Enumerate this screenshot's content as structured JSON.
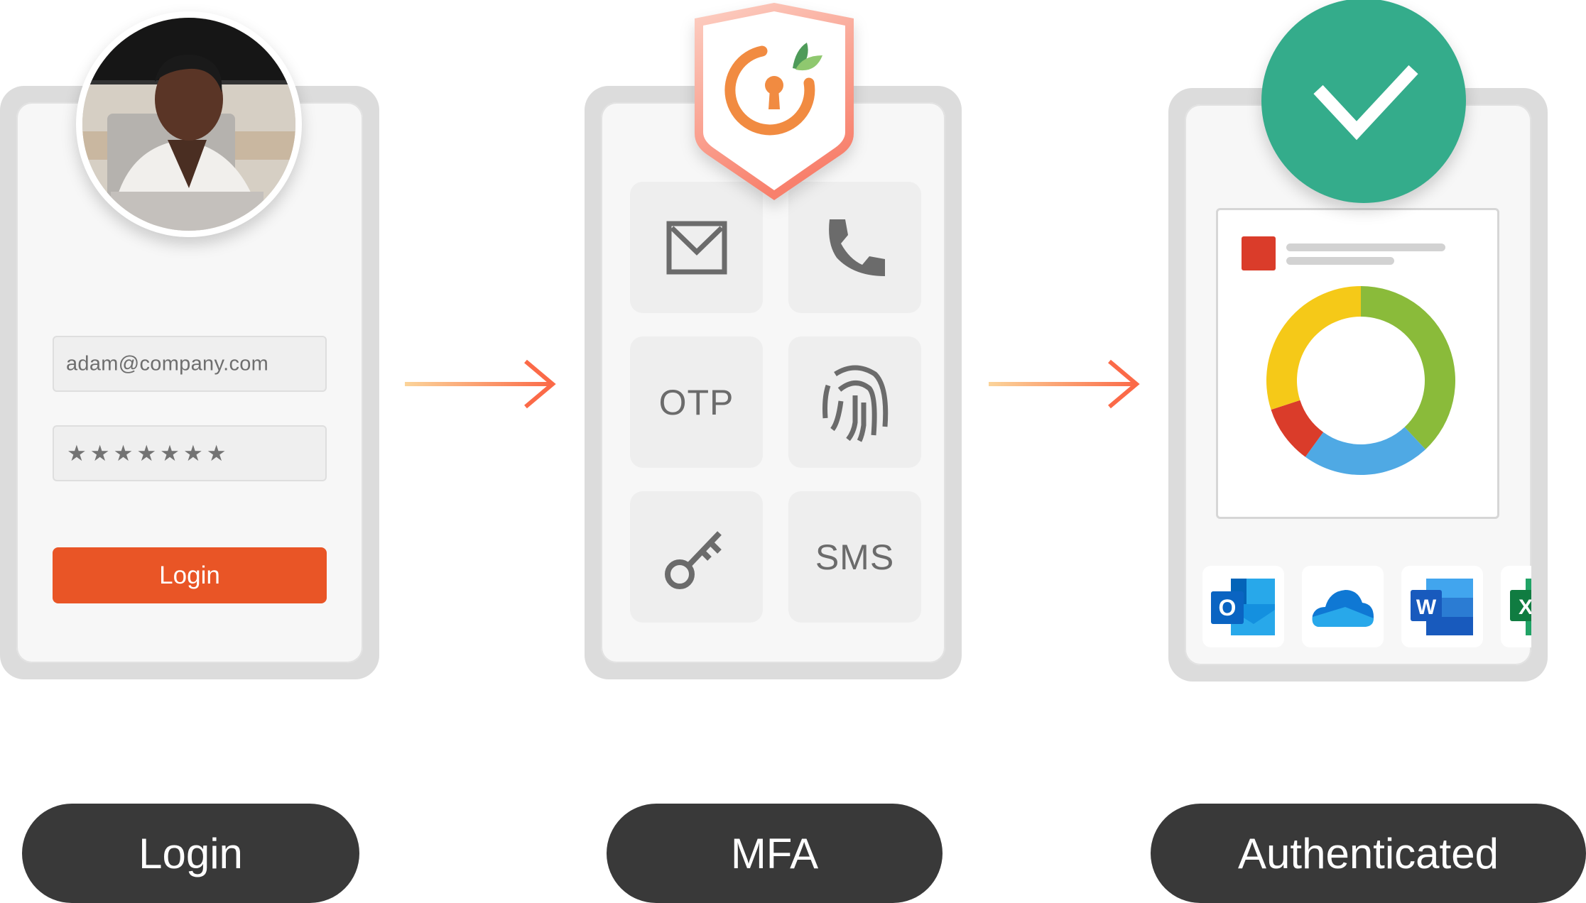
{
  "steps": [
    {
      "label": "Login"
    },
    {
      "label": "MFA"
    },
    {
      "label": "Authenticated"
    }
  ],
  "login_card": {
    "email_value": "adam@company.com",
    "password_mask": "★★★★★★★",
    "login_button": "Login"
  },
  "mfa_card": {
    "methods": [
      {
        "name": "Email",
        "icon": "envelope-icon"
      },
      {
        "name": "Phone call",
        "icon": "phone-icon"
      },
      {
        "name": "OTP",
        "text": "OTP"
      },
      {
        "name": "Biometric",
        "icon": "fingerprint-icon"
      },
      {
        "name": "Security key",
        "icon": "key-icon"
      },
      {
        "name": "SMS",
        "text": "SMS"
      }
    ]
  },
  "authenticated_card": {
    "apps": [
      "Outlook",
      "OneDrive",
      "Word",
      "Excel"
    ]
  },
  "colors": {
    "accent_orange": "#e95526",
    "shield_border": "#f8917a",
    "logo_orange": "#f18b41",
    "leaf_green": "#7cc36a",
    "check_green": "#34ac8b",
    "pill_dark": "#393939",
    "donut": [
      "#8abb3a",
      "#4fa9e4",
      "#da3c2a",
      "#f5c918"
    ]
  },
  "chart_data": {
    "type": "pie",
    "title": "",
    "categories": [
      "Green",
      "Blue",
      "Red",
      "Yellow"
    ],
    "values": [
      38,
      22,
      10,
      30
    ]
  }
}
